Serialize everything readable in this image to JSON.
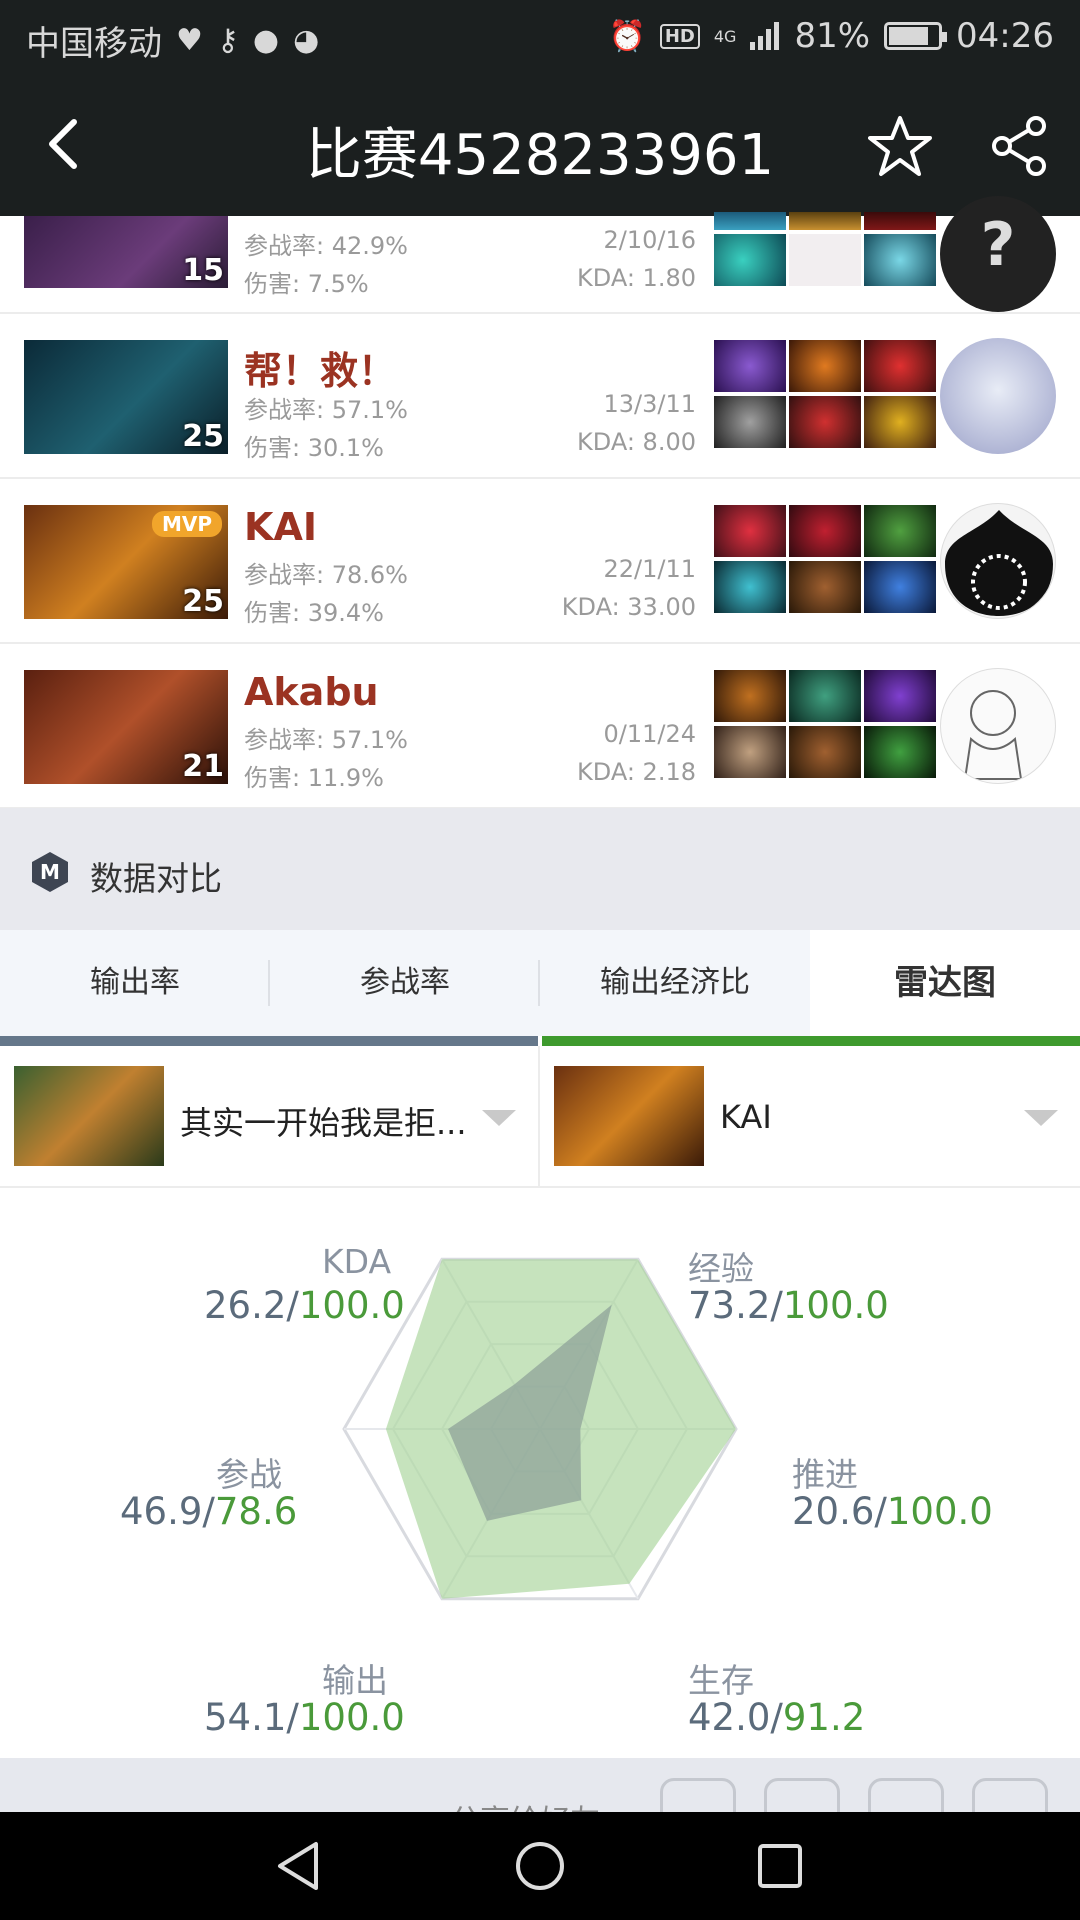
{
  "status": {
    "carrier": "中国移动",
    "network": "4G",
    "battery": "81%",
    "battery_level": 0.81,
    "time": "04:26"
  },
  "header": {
    "title": "比赛4528233961"
  },
  "players": [
    {
      "name": "",
      "level": "15",
      "participation": "参战率: 42.9%",
      "damage": "伤害: 7.5%",
      "kda_raw": "2/10/16",
      "kda": "KDA: 1.80",
      "mvp": false
    },
    {
      "name": "帮！救！",
      "level": "25",
      "participation": "参战率: 57.1%",
      "damage": "伤害: 30.1%",
      "kda_raw": "13/3/11",
      "kda": "KDA: 8.00",
      "mvp": false
    },
    {
      "name": "KAI",
      "level": "25",
      "participation": "参战率: 78.6%",
      "damage": "伤害: 39.4%",
      "kda_raw": "22/1/11",
      "kda": "KDA: 33.00",
      "mvp": true,
      "mvp_label": "MVP"
    },
    {
      "name": "Akabu",
      "level": "21",
      "participation": "参战率: 57.1%",
      "damage": "伤害: 11.9%",
      "kda_raw": "0/11/24",
      "kda": "KDA: 2.18",
      "mvp": false
    }
  ],
  "section": {
    "title": "数据对比"
  },
  "tabs": [
    {
      "label": "输出率",
      "active": false
    },
    {
      "label": "参战率",
      "active": false
    },
    {
      "label": "输出经济比",
      "active": false
    },
    {
      "label": "雷达图",
      "active": true
    }
  ],
  "compare": {
    "left_name": "其实一开始我是拒...",
    "right_name": "KAI"
  },
  "radar": {
    "axes": [
      {
        "label": "KDA",
        "left": "26.2/",
        "right": "100.0",
        "left_value": 26.2,
        "right_value": 100.0
      },
      {
        "label": "经验",
        "left": "73.2/",
        "right": "100.0",
        "left_value": 73.2,
        "right_value": 100.0
      },
      {
        "label": "推进",
        "left": "20.6/",
        "right": "100.0",
        "left_value": 20.6,
        "right_value": 100.0
      },
      {
        "label": "生存",
        "left": "42.0/",
        "right": "91.2",
        "left_value": 42.0,
        "right_value": 91.2
      },
      {
        "label": "输出",
        "left": "54.1/",
        "right": "100.0",
        "left_value": 54.1,
        "right_value": 100.0
      },
      {
        "label": "参战",
        "left": "46.9/",
        "right": "78.6",
        "left_value": 46.9,
        "right_value": 78.6
      }
    ],
    "max": 100,
    "colors": {
      "left": "#8fa39a",
      "right": "#a8d49a"
    }
  },
  "share": {
    "text": "分享给好友"
  }
}
